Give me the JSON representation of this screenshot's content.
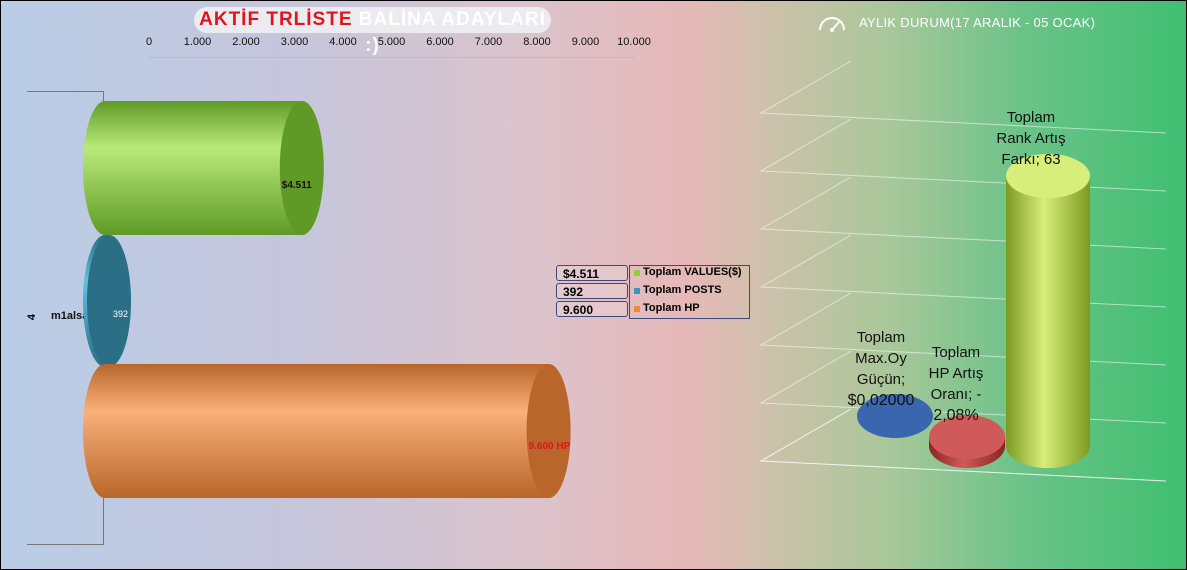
{
  "title": {
    "part1": "AKTİF TRLİSTE",
    "part2": "BALİNA ADAYLARI :)"
  },
  "chart_data": [
    {
      "type": "bar",
      "orientation": "horizontal",
      "x_ticks": [
        "0",
        "1.000",
        "2.000",
        "3.000",
        "4.000",
        "5.000",
        "6.000",
        "7.000",
        "8.000",
        "9.000",
        "10.000"
      ],
      "xlim": [
        0,
        10000
      ],
      "category_index": "4",
      "categories": [
        "m1alsan"
      ],
      "series": [
        {
          "name": "Toplam VALUES($)",
          "values": [
            4511
          ],
          "label": "$4.511",
          "legend_value": "$4.511",
          "color": "#8fcf3c"
        },
        {
          "name": "Toplam POSTS",
          "values": [
            392
          ],
          "label": "392",
          "legend_value": "392",
          "color": "#3a97b6"
        },
        {
          "name": "Toplam HP",
          "values": [
            9600
          ],
          "label": "9.600 HP",
          "legend_value": "9.600",
          "color": "#f08a3a"
        }
      ],
      "legend_position": "right"
    },
    {
      "type": "bar",
      "title": "AYLIK DURUM(17 ARALIK - 05 OCAK)",
      "series": [
        {
          "label_lines": [
            "Toplam",
            "Max.Oy",
            "Güçün;",
            "$0,02000"
          ],
          "value": 0.02,
          "color": "#3a66b0"
        },
        {
          "label_lines": [
            "Toplam",
            "HP Artış",
            "Oranı; -",
            "2,08%"
          ],
          "value": -2.08,
          "color": "#b23a3a"
        },
        {
          "label_lines": [
            "Toplam",
            "Rank Artış",
            "Farkı; 63"
          ],
          "value": 63,
          "color": "#a8c83c"
        }
      ]
    }
  ],
  "icons": {
    "gauge": "speedometer-icon"
  }
}
